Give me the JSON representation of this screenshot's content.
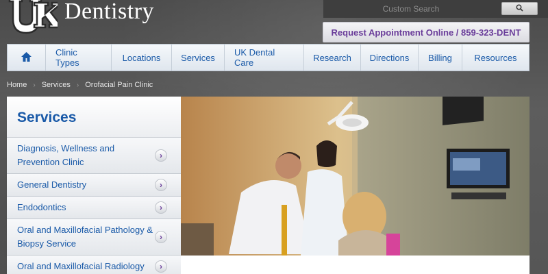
{
  "header": {
    "logo_text": "Dentistry",
    "uk_letters": "UK",
    "search_placeholder": "Custom Search",
    "search_icon": "search-icon",
    "appointment_label": "Request Appointment Online / 859-323-DENT"
  },
  "nav": {
    "home_icon": "home-icon",
    "items": [
      {
        "label": "Clinic Types"
      },
      {
        "label": "Locations"
      },
      {
        "label": "Services"
      },
      {
        "label": "UK Dental Care"
      },
      {
        "label": "Research"
      },
      {
        "label": "Directions"
      },
      {
        "label": "Billing"
      },
      {
        "label": "Resources"
      }
    ]
  },
  "breadcrumb": {
    "items": [
      {
        "label": "Home"
      },
      {
        "label": "Services"
      },
      {
        "label": "Orofacial Pain Clinic"
      }
    ],
    "separator": "›"
  },
  "sidebar": {
    "title": "Services",
    "chevron": "›",
    "items": [
      {
        "label": "Diagnosis, Wellness and Prevention Clinic"
      },
      {
        "label": "General Dentistry"
      },
      {
        "label": "Endodontics"
      },
      {
        "label": "Oral and Maxillofacial Pathology & Biopsy Service"
      },
      {
        "label": "Oral and Maxillofacial Radiology"
      }
    ]
  },
  "colors": {
    "link_blue": "#1a5aa8",
    "accent_purple": "#6a3d9a",
    "background_gray": "#555555"
  }
}
